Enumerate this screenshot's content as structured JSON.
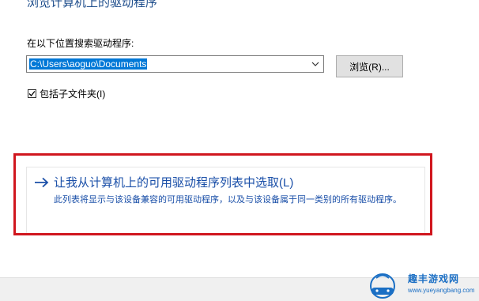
{
  "page": {
    "title": "浏览计算机上的驱动程序"
  },
  "search": {
    "label": "在以下位置搜索驱动程序:",
    "path_value": "C:\\Users\\aoguo\\Documents",
    "browse_label": "浏览(R)...",
    "include_subfolders_label": "包括子文件夹(I)",
    "include_subfolders_checked": true
  },
  "pick_option": {
    "title": "让我从计算机上的可用驱动程序列表中选取(L)",
    "description": "此列表将显示与该设备兼容的可用驱动程序，以及与该设备属于同一类别的所有驱动程序。"
  },
  "highlight": {
    "color": "#d0161e"
  },
  "watermark": {
    "text": "趣丰游戏网",
    "url": "www.yueyangbang.com"
  },
  "colors": {
    "link_blue": "#1a4fa8",
    "selection_blue": "#0078d7"
  }
}
